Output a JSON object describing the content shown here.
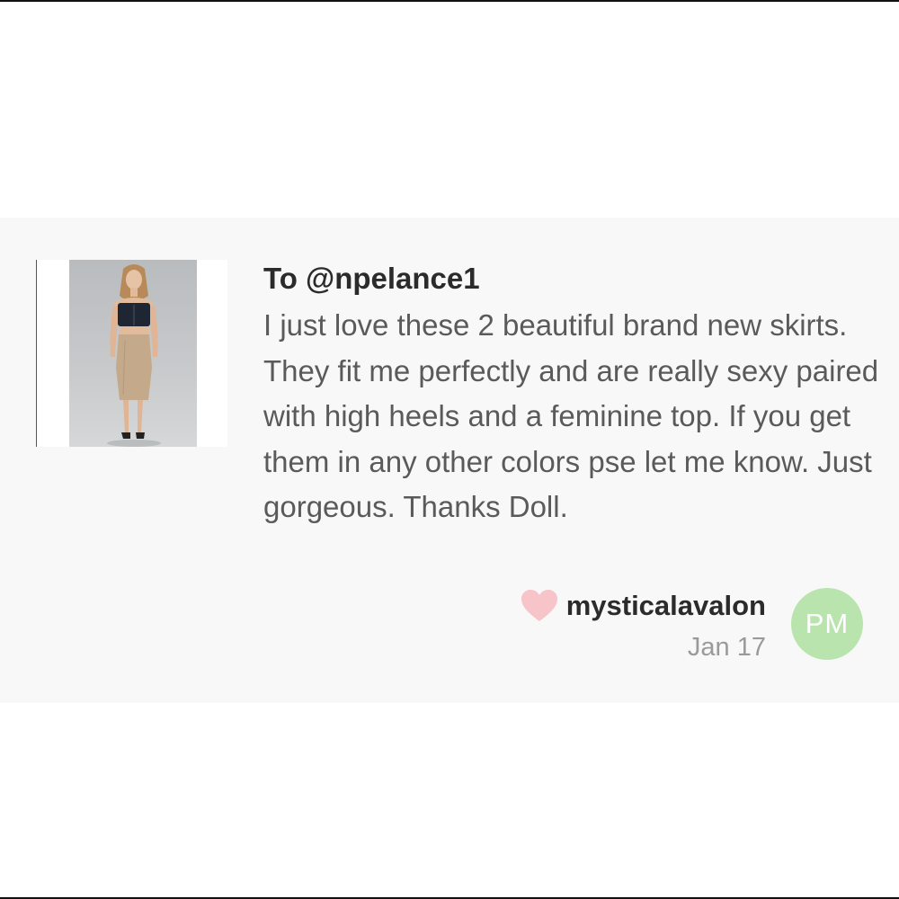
{
  "review": {
    "recipient": "To @npelance1",
    "message": "I just love these 2 beautiful brand new skirts. They fit me perfectly and are really sexy paired with high heels and a feminine top. If you get them in any other colors pse let me know. Just gorgeous. Thanks Doll.",
    "username": "mysticalavalon",
    "date": "Jan 17",
    "avatar_initials": "PM",
    "heart_icon": "heart-icon",
    "product_image": "product-photo-model-in-strapless-top-and-tan-midi-skirt"
  },
  "colors": {
    "card_background": "#f8f8f8",
    "heart": "#f7c4c9",
    "avatar": "#b9e4ad",
    "username": "#2b2b2b",
    "message": "#5a5a5a",
    "date": "#9a9a9a"
  }
}
